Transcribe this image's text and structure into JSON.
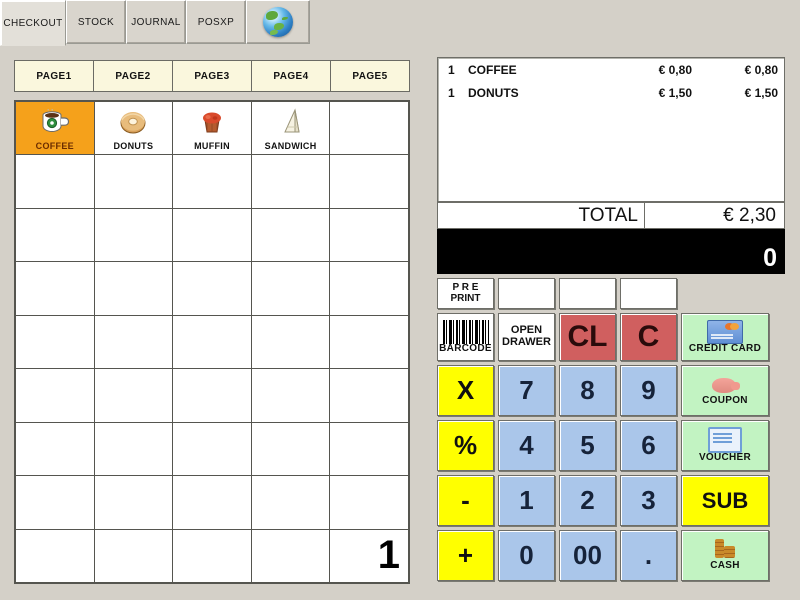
{
  "tabs": [
    {
      "label": "CHECKOUT",
      "active": true
    },
    {
      "label": "STOCK",
      "active": false
    },
    {
      "label": "JOURNAL",
      "active": false
    },
    {
      "label": "POSXP",
      "active": false
    },
    {
      "label": "",
      "icon": "globe-icon",
      "active": false
    }
  ],
  "pages": [
    {
      "label": "PAGE1"
    },
    {
      "label": "PAGE2"
    },
    {
      "label": "PAGE3"
    },
    {
      "label": "PAGE4"
    },
    {
      "label": "PAGE5"
    }
  ],
  "products": [
    {
      "label": "COFFEE",
      "icon": "coffee-cup-icon",
      "selected": true
    },
    {
      "label": "DONUTS",
      "icon": "donut-icon",
      "selected": false
    },
    {
      "label": "MUFFIN",
      "icon": "muffin-icon",
      "selected": false
    },
    {
      "label": "SANDWICH",
      "icon": "sandwich-icon",
      "selected": false
    }
  ],
  "grid": {
    "columns": 5,
    "rows": 9,
    "quantity_cell": {
      "row": 9,
      "column": 5,
      "value": "1"
    }
  },
  "receipt": {
    "lines": [
      {
        "qty": "1",
        "name": "COFFEE",
        "price": "€ 0,80",
        "total": "€ 0,80"
      },
      {
        "qty": "1",
        "name": "DONUTS",
        "price": "€ 1,50",
        "total": "€ 1,50"
      }
    ],
    "total_label": "TOTAL",
    "total_value": "€ 2,30",
    "display_value": "0"
  },
  "keypad": {
    "row_fn": [
      {
        "label": "P R E\nPRINT",
        "line1": "P R E",
        "line2": "PRINT",
        "style": "white"
      },
      {
        "label": "",
        "style": "white"
      },
      {
        "label": "",
        "style": "white"
      },
      {
        "label": "",
        "style": "white"
      },
      {
        "label": "",
        "style": "none"
      }
    ],
    "row_1": [
      {
        "label": "BARCODE",
        "icon": "barcode-icon",
        "style": "white"
      },
      {
        "line1": "OPEN",
        "line2": "DRAWER",
        "style": "white"
      },
      {
        "label": "CL",
        "style": "red"
      },
      {
        "label": "C",
        "style": "red"
      },
      {
        "label": "CREDIT CARD",
        "icon": "credit-card-icon",
        "style": "green"
      }
    ],
    "row_2": [
      {
        "label": "X",
        "style": "yellow"
      },
      {
        "label": "7",
        "style": "blue"
      },
      {
        "label": "8",
        "style": "blue"
      },
      {
        "label": "9",
        "style": "blue"
      },
      {
        "label": "COUPON",
        "icon": "piggy-bank-icon",
        "style": "green"
      }
    ],
    "row_3": [
      {
        "label": "%",
        "style": "yellow"
      },
      {
        "label": "4",
        "style": "blue"
      },
      {
        "label": "5",
        "style": "blue"
      },
      {
        "label": "6",
        "style": "blue"
      },
      {
        "label": "VOUCHER",
        "icon": "voucher-icon",
        "style": "green"
      }
    ],
    "row_4": [
      {
        "label": "-",
        "style": "yellow"
      },
      {
        "label": "1",
        "style": "blue"
      },
      {
        "label": "2",
        "style": "blue"
      },
      {
        "label": "3",
        "style": "blue"
      },
      {
        "label": "SUB",
        "style": "yellow"
      }
    ],
    "row_5": [
      {
        "label": "+",
        "style": "yellow"
      },
      {
        "label": "0",
        "style": "blue"
      },
      {
        "label": "00",
        "style": "blue"
      },
      {
        "label": ".",
        "style": "blue"
      },
      {
        "label": "CASH",
        "icon": "coins-icon",
        "style": "green"
      }
    ]
  },
  "colors": {
    "background": "#d4d0c8",
    "selected_product": "#f5a11b",
    "page_button": "#faf7dd",
    "key_red": "#d05f5f",
    "key_yellow": "#ffff00",
    "key_blue": "#aac6ea",
    "key_green": "#c2f3c2",
    "display_bg": "#000000"
  }
}
